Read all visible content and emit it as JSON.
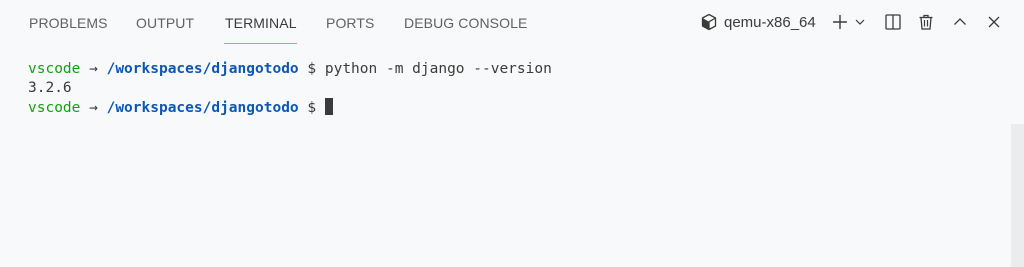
{
  "tabs": [
    {
      "label": "PROBLEMS"
    },
    {
      "label": "OUTPUT"
    },
    {
      "label": "TERMINAL",
      "active": true
    },
    {
      "label": "PORTS"
    },
    {
      "label": "DEBUG CONSOLE"
    }
  ],
  "toolbar": {
    "profile_name": "qemu-x86_64",
    "icons": [
      "terminal-profile-icon",
      "add-icon",
      "chevron-down-icon",
      "split-icon",
      "trash-icon",
      "chevron-up-icon",
      "close-icon"
    ]
  },
  "terminal": {
    "lines": [
      {
        "user": "vscode",
        "arrow": " → ",
        "path": "/workspaces/djangotodo",
        "prompt": " $ ",
        "command": "python -m django --version"
      },
      {
        "output": "3.2.6"
      },
      {
        "user": "vscode",
        "arrow": " → ",
        "path": "/workspaces/djangotodo",
        "prompt": " $ ",
        "command": ""
      }
    ]
  },
  "colors": {
    "background": "#f8f9fa",
    "active_tab_underline": "#f28b6c",
    "prompt_user": "#10a30d",
    "prompt_path": "#0b57b5",
    "text": "#3b3b3b"
  }
}
